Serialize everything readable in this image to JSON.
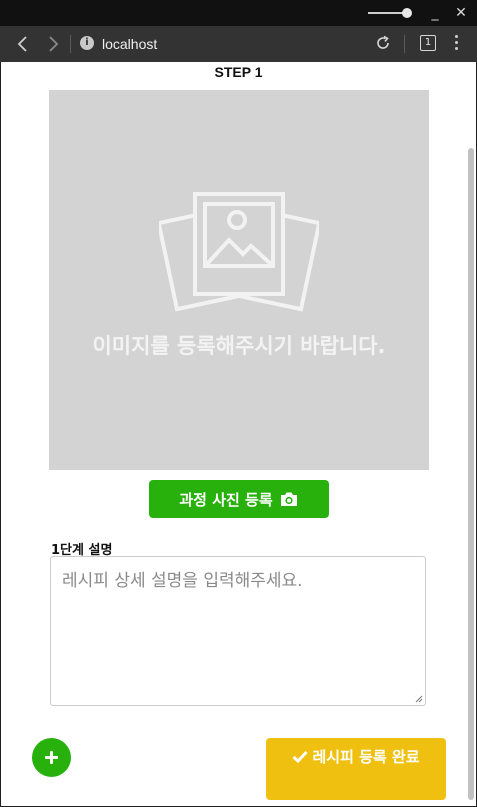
{
  "browser": {
    "url": "localhost",
    "tab_count": "1",
    "minimize_glyph": "_",
    "close_glyph": "✕"
  },
  "step": {
    "title": "STEP 1",
    "image_placeholder": "이미지를 등록해주시기 바랍니다.",
    "photo_button_label": "과정 사진 등록",
    "description_label": "1단계 설명",
    "description_placeholder": "레시피 상세 설명을 입력해주세요.",
    "description_value": ""
  },
  "actions": {
    "complete_label": "레시피 등록 완료"
  },
  "icons": {
    "photo": "camera-icon",
    "add": "plus-icon",
    "complete": "check-icon",
    "placeholder": "gallery-icon"
  },
  "colors": {
    "green": "#28b10c",
    "yellow": "#f0c010",
    "placeholder_bg": "#d3d3d3"
  }
}
